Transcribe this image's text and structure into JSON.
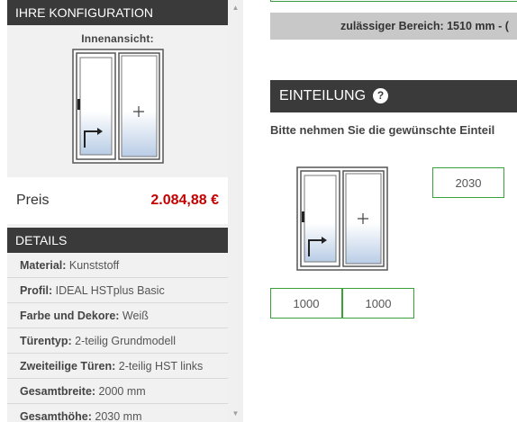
{
  "sidebar": {
    "config_title": "IHRE KONFIGURATION",
    "view_label": "Innenansicht:",
    "price_label": "Preis",
    "price_value": "2.084,88 €",
    "details_title": "DETAILS",
    "details": [
      {
        "key": "Material:",
        "value": "Kunststoff"
      },
      {
        "key": "Profil:",
        "value": "IDEAL HSTplus Basic"
      },
      {
        "key": "Farbe und Dekore:",
        "value": "Weiß"
      },
      {
        "key": "Türentyp:",
        "value": "2-teilig Grundmodell"
      },
      {
        "key": "Zweiteilige Türen:",
        "value": "2-teilig HST links"
      },
      {
        "key": "Gesamtbreite:",
        "value": "2000 mm"
      },
      {
        "key": "Gesamthöhe:",
        "value": "2030 mm"
      }
    ]
  },
  "main": {
    "range_text": "zulässiger Bereich: 1510 mm - (",
    "section_title": "EINTEILUNG",
    "help_icon_glyph": "?",
    "instruction": "Bitte nehmen Sie die gewünschte Einteil",
    "height_value": "2030",
    "width_left_value": "1000",
    "width_right_value": "1000"
  },
  "colors": {
    "header_bg": "#3a3a3a",
    "price": "#c40000",
    "input_border": "#3aa03a"
  }
}
